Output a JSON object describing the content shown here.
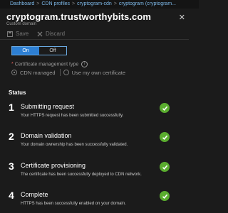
{
  "breadcrumb": [
    "Dashboard",
    "CDN profiles",
    "cryptogram-cdn",
    "cryptogram (cryptogram..."
  ],
  "blade": {
    "title": "cryptogram.trustworthybits.com",
    "subtitle": "Custom domain"
  },
  "toolbar": {
    "save_label": "Save",
    "discard_label": "Discard"
  },
  "https_toggle": {
    "on_label": "On",
    "off_label": "Off",
    "selected": "On"
  },
  "cert_type": {
    "label": "Certificate management type",
    "options": [
      "CDN managed",
      "Use my own certificate"
    ],
    "selected": "CDN managed"
  },
  "status": {
    "heading": "Status",
    "steps": [
      {
        "number": "1",
        "title": "Submitting request",
        "description": "Your HTTPS request has been submitted successfully.",
        "state": "done"
      },
      {
        "number": "2",
        "title": "Domain validation",
        "description": "Your domain ownership has been successfully validated.",
        "state": "done"
      },
      {
        "number": "3",
        "title": "Certificate provisioning",
        "description": "The certificate has been successfully deployed to CDN network.",
        "state": "done"
      },
      {
        "number": "4",
        "title": "Complete",
        "description": "HTTPS has been successfully enabled on your domain.",
        "state": "done"
      }
    ]
  },
  "colors": {
    "accent": "#2d7fd3",
    "success": "#5aad2f",
    "required": "#e0615b",
    "link": "#7db8e8"
  }
}
